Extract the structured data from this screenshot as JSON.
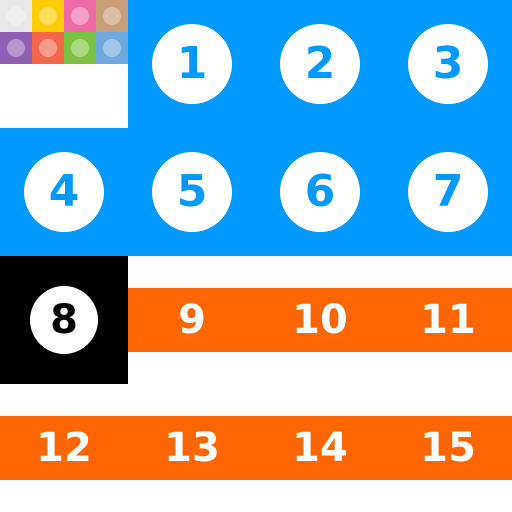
{
  "colors": {
    "blue": "#0099ff",
    "orange": "#ff6600",
    "black": "#000000",
    "white": "#ffffff"
  },
  "palette": {
    "swatches": [
      {
        "name": "white",
        "color": "#e8e8e8"
      },
      {
        "name": "yellow",
        "color": "#ffcc00"
      },
      {
        "name": "pink",
        "color": "#f06aa8"
      },
      {
        "name": "tan",
        "color": "#c9a07a"
      },
      {
        "name": "purple",
        "color": "#8e5fb3"
      },
      {
        "name": "coral",
        "color": "#f2664a"
      },
      {
        "name": "green",
        "color": "#7cc242"
      },
      {
        "name": "light-blue",
        "color": "#6fa8dc"
      }
    ]
  },
  "tiles": [
    {
      "number": "1",
      "style": "blue"
    },
    {
      "number": "2",
      "style": "blue"
    },
    {
      "number": "3",
      "style": "blue"
    },
    {
      "number": "4",
      "style": "blue"
    },
    {
      "number": "5",
      "style": "blue"
    },
    {
      "number": "6",
      "style": "blue"
    },
    {
      "number": "7",
      "style": "blue"
    },
    {
      "number": "8",
      "style": "black"
    },
    {
      "number": "9",
      "style": "stripe"
    },
    {
      "number": "10",
      "style": "stripe"
    },
    {
      "number": "11",
      "style": "stripe"
    },
    {
      "number": "12",
      "style": "stripe"
    },
    {
      "number": "13",
      "style": "stripe"
    },
    {
      "number": "14",
      "style": "stripe"
    },
    {
      "number": "15",
      "style": "stripe"
    }
  ]
}
